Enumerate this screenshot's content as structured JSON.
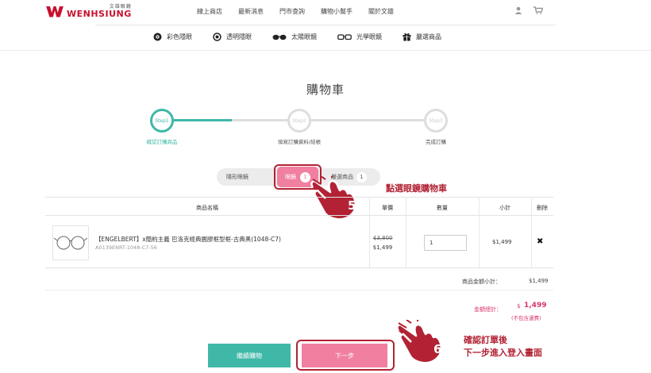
{
  "header": {
    "logo_sub": "文雄眼鏡",
    "logo_main": "WENHSIUNG",
    "nav": [
      "線上商店",
      "最新消息",
      "門市查詢",
      "購物小幫手",
      "關於文雄"
    ],
    "icons": [
      "user-icon",
      "cart-icon"
    ]
  },
  "categories": [
    {
      "label": "彩色隱眼",
      "icon": "color-lens-icon"
    },
    {
      "label": "透明隱眼",
      "icon": "clear-lens-icon"
    },
    {
      "label": "太陽眼鏡",
      "icon": "sunglasses-icon"
    },
    {
      "label": "光學眼鏡",
      "icon": "optical-glasses-icon"
    },
    {
      "label": "嚴選商品",
      "icon": "gift-icon"
    }
  ],
  "page_title": "購物車",
  "steps": [
    {
      "circle": "Step1",
      "label": "確認訂購商品"
    },
    {
      "circle": "Step2",
      "label": "填寫訂購資料/結帳"
    },
    {
      "circle": "Step3",
      "label": "完成訂購"
    }
  ],
  "tabs": {
    "contact": "隱形眼鏡",
    "glasses": "眼鏡",
    "glasses_count": "1",
    "other": "嚴選商品",
    "other_count": "1"
  },
  "table": {
    "headers": [
      "商品名稱",
      "單價",
      "數量",
      "小計",
      "刪除"
    ],
    "row": {
      "name": "【ENGELBERT】x簡約主義 巴洛克經典圓膠框型框-古典黑(1048-C7)",
      "sku": "A0139ENRT-1048-C7-56",
      "old_price": "$3,800",
      "price": "$1,499",
      "qty": "1",
      "subtotal": "$1,499",
      "delete": "✖"
    }
  },
  "summary": {
    "subtotal_label": "商品金額小計：",
    "subtotal_value": "$1,499",
    "total_label": "金額總計：",
    "total_currency": "$",
    "total_value": "1,499",
    "total_note": "(不包含運費)"
  },
  "buttons": {
    "continue": "繼續購物",
    "next": "下一步"
  },
  "annotations": {
    "num5": "5",
    "text5": "點選眼鏡購物車",
    "num6": "6",
    "text6_line1": "確認訂單後",
    "text6_line2": "下一步進入登入畫面"
  },
  "colors": {
    "teal": "#3fb8a8",
    "pink": "#f07fa0",
    "annotation_red": "#b22234"
  }
}
